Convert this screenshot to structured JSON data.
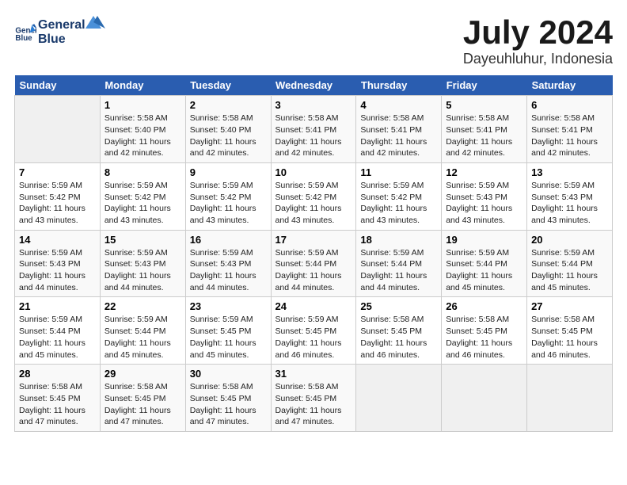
{
  "header": {
    "logo_line1": "General",
    "logo_line2": "Blue",
    "month": "July 2024",
    "location": "Dayeuhluhur, Indonesia"
  },
  "weekdays": [
    "Sunday",
    "Monday",
    "Tuesday",
    "Wednesday",
    "Thursday",
    "Friday",
    "Saturday"
  ],
  "weeks": [
    [
      {
        "day": "",
        "info": ""
      },
      {
        "day": "1",
        "info": "Sunrise: 5:58 AM\nSunset: 5:40 PM\nDaylight: 11 hours\nand 42 minutes."
      },
      {
        "day": "2",
        "info": "Sunrise: 5:58 AM\nSunset: 5:40 PM\nDaylight: 11 hours\nand 42 minutes."
      },
      {
        "day": "3",
        "info": "Sunrise: 5:58 AM\nSunset: 5:41 PM\nDaylight: 11 hours\nand 42 minutes."
      },
      {
        "day": "4",
        "info": "Sunrise: 5:58 AM\nSunset: 5:41 PM\nDaylight: 11 hours\nand 42 minutes."
      },
      {
        "day": "5",
        "info": "Sunrise: 5:58 AM\nSunset: 5:41 PM\nDaylight: 11 hours\nand 42 minutes."
      },
      {
        "day": "6",
        "info": "Sunrise: 5:58 AM\nSunset: 5:41 PM\nDaylight: 11 hours\nand 42 minutes."
      }
    ],
    [
      {
        "day": "7",
        "info": "Sunrise: 5:59 AM\nSunset: 5:42 PM\nDaylight: 11 hours\nand 43 minutes."
      },
      {
        "day": "8",
        "info": "Sunrise: 5:59 AM\nSunset: 5:42 PM\nDaylight: 11 hours\nand 43 minutes."
      },
      {
        "day": "9",
        "info": "Sunrise: 5:59 AM\nSunset: 5:42 PM\nDaylight: 11 hours\nand 43 minutes."
      },
      {
        "day": "10",
        "info": "Sunrise: 5:59 AM\nSunset: 5:42 PM\nDaylight: 11 hours\nand 43 minutes."
      },
      {
        "day": "11",
        "info": "Sunrise: 5:59 AM\nSunset: 5:42 PM\nDaylight: 11 hours\nand 43 minutes."
      },
      {
        "day": "12",
        "info": "Sunrise: 5:59 AM\nSunset: 5:43 PM\nDaylight: 11 hours\nand 43 minutes."
      },
      {
        "day": "13",
        "info": "Sunrise: 5:59 AM\nSunset: 5:43 PM\nDaylight: 11 hours\nand 43 minutes."
      }
    ],
    [
      {
        "day": "14",
        "info": "Sunrise: 5:59 AM\nSunset: 5:43 PM\nDaylight: 11 hours\nand 44 minutes."
      },
      {
        "day": "15",
        "info": "Sunrise: 5:59 AM\nSunset: 5:43 PM\nDaylight: 11 hours\nand 44 minutes."
      },
      {
        "day": "16",
        "info": "Sunrise: 5:59 AM\nSunset: 5:43 PM\nDaylight: 11 hours\nand 44 minutes."
      },
      {
        "day": "17",
        "info": "Sunrise: 5:59 AM\nSunset: 5:44 PM\nDaylight: 11 hours\nand 44 minutes."
      },
      {
        "day": "18",
        "info": "Sunrise: 5:59 AM\nSunset: 5:44 PM\nDaylight: 11 hours\nand 44 minutes."
      },
      {
        "day": "19",
        "info": "Sunrise: 5:59 AM\nSunset: 5:44 PM\nDaylight: 11 hours\nand 45 minutes."
      },
      {
        "day": "20",
        "info": "Sunrise: 5:59 AM\nSunset: 5:44 PM\nDaylight: 11 hours\nand 45 minutes."
      }
    ],
    [
      {
        "day": "21",
        "info": "Sunrise: 5:59 AM\nSunset: 5:44 PM\nDaylight: 11 hours\nand 45 minutes."
      },
      {
        "day": "22",
        "info": "Sunrise: 5:59 AM\nSunset: 5:44 PM\nDaylight: 11 hours\nand 45 minutes."
      },
      {
        "day": "23",
        "info": "Sunrise: 5:59 AM\nSunset: 5:45 PM\nDaylight: 11 hours\nand 45 minutes."
      },
      {
        "day": "24",
        "info": "Sunrise: 5:59 AM\nSunset: 5:45 PM\nDaylight: 11 hours\nand 46 minutes."
      },
      {
        "day": "25",
        "info": "Sunrise: 5:58 AM\nSunset: 5:45 PM\nDaylight: 11 hours\nand 46 minutes."
      },
      {
        "day": "26",
        "info": "Sunrise: 5:58 AM\nSunset: 5:45 PM\nDaylight: 11 hours\nand 46 minutes."
      },
      {
        "day": "27",
        "info": "Sunrise: 5:58 AM\nSunset: 5:45 PM\nDaylight: 11 hours\nand 46 minutes."
      }
    ],
    [
      {
        "day": "28",
        "info": "Sunrise: 5:58 AM\nSunset: 5:45 PM\nDaylight: 11 hours\nand 47 minutes."
      },
      {
        "day": "29",
        "info": "Sunrise: 5:58 AM\nSunset: 5:45 PM\nDaylight: 11 hours\nand 47 minutes."
      },
      {
        "day": "30",
        "info": "Sunrise: 5:58 AM\nSunset: 5:45 PM\nDaylight: 11 hours\nand 47 minutes."
      },
      {
        "day": "31",
        "info": "Sunrise: 5:58 AM\nSunset: 5:45 PM\nDaylight: 11 hours\nand 47 minutes."
      },
      {
        "day": "",
        "info": ""
      },
      {
        "day": "",
        "info": ""
      },
      {
        "day": "",
        "info": ""
      }
    ]
  ]
}
